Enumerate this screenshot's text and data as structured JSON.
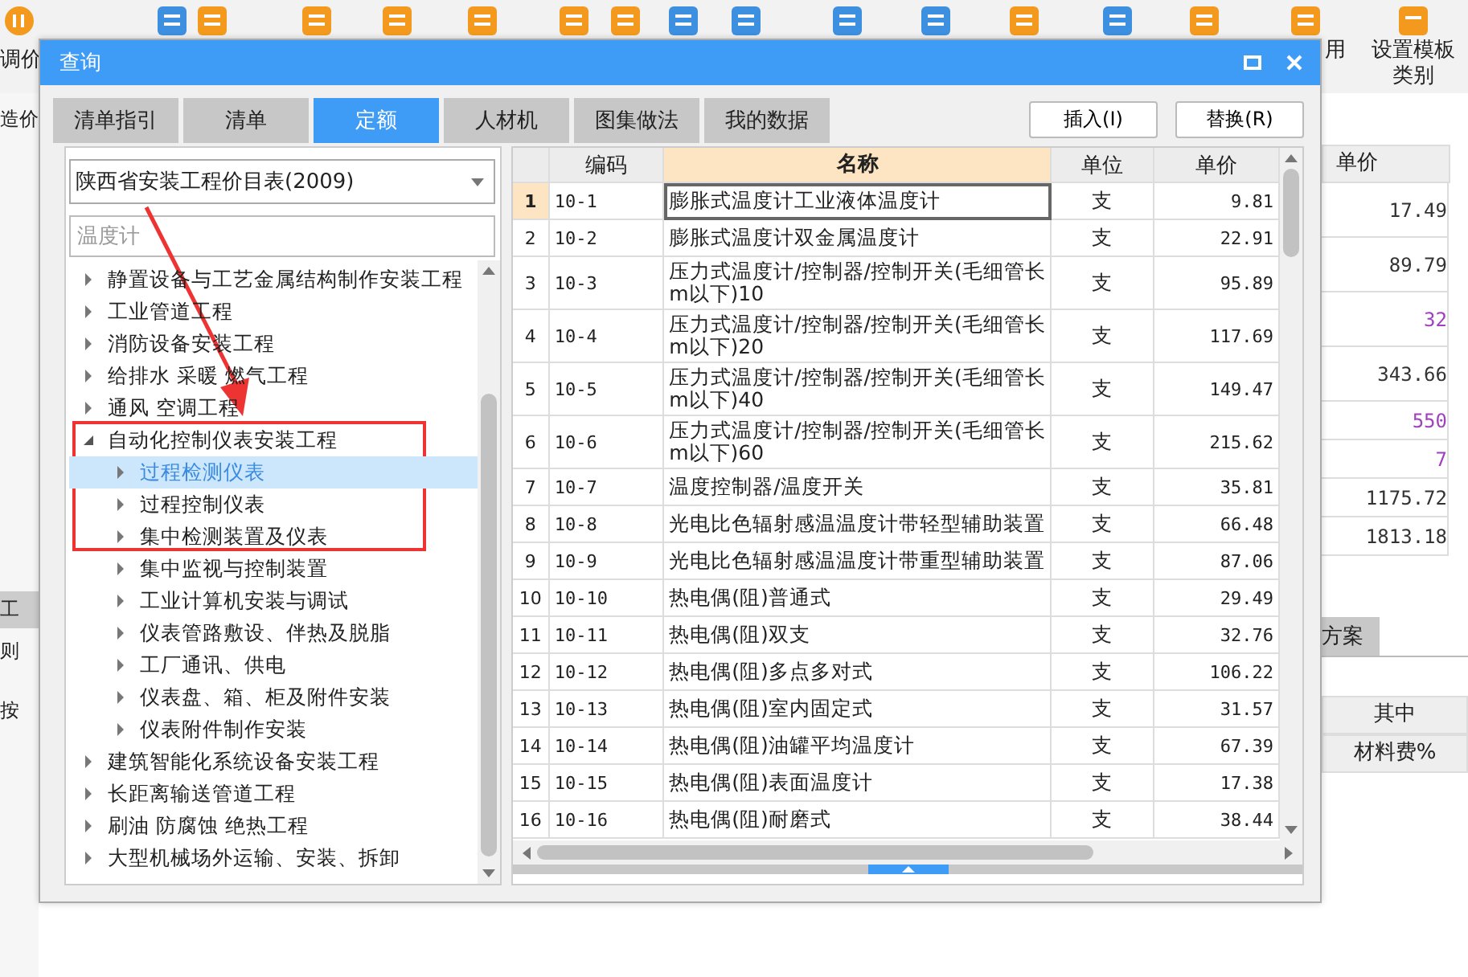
{
  "app": {
    "toolbar_left_label": "调价",
    "toolbar_right_labels": [
      "用",
      "设置模板类别"
    ],
    "side_labels": [
      "造价",
      "工",
      "则",
      "按"
    ],
    "price_column": {
      "header": "单价",
      "values": [
        {
          "text": "17.49",
          "color": "#333333"
        },
        {
          "text": "89.79",
          "color": "#333333"
        },
        {
          "text": "32",
          "color": "#a040c0"
        },
        {
          "text": "343.66",
          "color": "#333333"
        },
        {
          "text": "550",
          "color": "#a040c0"
        },
        {
          "text": "7",
          "color": "#a040c0"
        },
        {
          "text": "1175.72",
          "color": "#333333"
        },
        {
          "text": "1813.18",
          "color": "#333333"
        }
      ]
    },
    "lower_tab": "方案",
    "lower_headers": [
      "其中",
      "材料费%"
    ]
  },
  "window": {
    "title": "查询"
  },
  "tabs": [
    {
      "label": "清单指引",
      "selected": false
    },
    {
      "label": "清单",
      "selected": false
    },
    {
      "label": "定额",
      "selected": true
    },
    {
      "label": "人材机",
      "selected": false
    },
    {
      "label": "图集做法",
      "selected": false
    },
    {
      "label": "我的数据",
      "selected": false
    }
  ],
  "buttons": [
    "插入(I)",
    "替换(R)"
  ],
  "library_select": {
    "value": "陕西省安装工程价目表(2009)"
  },
  "search": {
    "placeholder": "温度计"
  },
  "tree": {
    "items": [
      {
        "label": "静置设备与工艺金属结构制作安装工程",
        "expanded": false,
        "selected": false
      },
      {
        "label": "工业管道工程",
        "expanded": false,
        "selected": false
      },
      {
        "label": "消防设备安装工程",
        "expanded": false,
        "selected": false
      },
      {
        "label": "给排水 采暖 燃气工程",
        "expanded": false,
        "selected": false
      },
      {
        "label": "通风 空调工程",
        "expanded": false,
        "selected": false
      },
      {
        "label": "自动化控制仪表安装工程",
        "expanded": true,
        "selected": false,
        "children": [
          {
            "label": "过程检测仪表",
            "expanded": false,
            "selected": true
          },
          {
            "label": "过程控制仪表",
            "expanded": false,
            "selected": false
          },
          {
            "label": "集中检测装置及仪表",
            "expanded": false,
            "selected": false
          },
          {
            "label": "集中监视与控制装置",
            "expanded": false,
            "selected": false
          },
          {
            "label": "工业计算机安装与调试",
            "expanded": false,
            "selected": false
          },
          {
            "label": "仪表管路敷设、伴热及脱脂",
            "expanded": false,
            "selected": false
          },
          {
            "label": "工厂通讯、供电",
            "expanded": false,
            "selected": false
          },
          {
            "label": "仪表盘、箱、柜及附件安装",
            "expanded": false,
            "selected": false
          },
          {
            "label": "仪表附件制作安装",
            "expanded": false,
            "selected": false
          }
        ]
      },
      {
        "label": "建筑智能化系统设备安装工程",
        "expanded": false,
        "selected": false
      },
      {
        "label": "长距离输送管道工程",
        "expanded": false,
        "selected": false
      },
      {
        "label": "刷油 防腐蚀 绝热工程",
        "expanded": false,
        "selected": false
      },
      {
        "label": "大型机械场外运输、安装、拆卸",
        "expanded": false,
        "selected": false
      }
    ]
  },
  "table": {
    "columns": [
      {
        "label": "编码",
        "selected": false
      },
      {
        "label": "名称",
        "selected": true
      },
      {
        "label": "单位",
        "selected": false
      },
      {
        "label": "单价",
        "selected": false
      }
    ],
    "rows": [
      {
        "no": "1",
        "code": "10-1",
        "name": "膨胀式温度计工业液体温度计",
        "unit": "支",
        "price": "9.81",
        "selected": true
      },
      {
        "no": "2",
        "code": "10-2",
        "name": "膨胀式温度计双金属温度计",
        "unit": "支",
        "price": "22.91",
        "selected": false
      },
      {
        "no": "3",
        "code": "10-3",
        "name": "压力式温度计/控制器/控制开关(毛细管长m以下)10",
        "unit": "支",
        "price": "95.89",
        "selected": false
      },
      {
        "no": "4",
        "code": "10-4",
        "name": "压力式温度计/控制器/控制开关(毛细管长m以下)20",
        "unit": "支",
        "price": "117.69",
        "selected": false
      },
      {
        "no": "5",
        "code": "10-5",
        "name": "压力式温度计/控制器/控制开关(毛细管长m以下)40",
        "unit": "支",
        "price": "149.47",
        "selected": false
      },
      {
        "no": "6",
        "code": "10-6",
        "name": "压力式温度计/控制器/控制开关(毛细管长m以下)60",
        "unit": "支",
        "price": "215.62",
        "selected": false
      },
      {
        "no": "7",
        "code": "10-7",
        "name": "温度控制器/温度开关",
        "unit": "支",
        "price": "35.81",
        "selected": false
      },
      {
        "no": "8",
        "code": "10-8",
        "name": "光电比色辐射感温温度计带轻型辅助装置",
        "unit": "支",
        "price": "66.48",
        "selected": false
      },
      {
        "no": "9",
        "code": "10-9",
        "name": "光电比色辐射感温温度计带重型辅助装置",
        "unit": "支",
        "price": "87.06",
        "selected": false
      },
      {
        "no": "10",
        "code": "10-10",
        "name": "热电偶(阻)普通式",
        "unit": "支",
        "price": "29.49",
        "selected": false
      },
      {
        "no": "11",
        "code": "10-11",
        "name": "热电偶(阻)双支",
        "unit": "支",
        "price": "32.76",
        "selected": false
      },
      {
        "no": "12",
        "code": "10-12",
        "name": "热电偶(阻)多点多对式",
        "unit": "支",
        "price": "106.22",
        "selected": false
      },
      {
        "no": "13",
        "code": "10-13",
        "name": "热电偶(阻)室内固定式",
        "unit": "支",
        "price": "31.57",
        "selected": false
      },
      {
        "no": "14",
        "code": "10-14",
        "name": "热电偶(阻)油罐平均温度计",
        "unit": "支",
        "price": "67.39",
        "selected": false
      },
      {
        "no": "15",
        "code": "10-15",
        "name": "热电偶(阻)表面温度计",
        "unit": "支",
        "price": "17.38",
        "selected": false
      },
      {
        "no": "16",
        "code": "10-16",
        "name": "热电偶(阻)耐磨式",
        "unit": "支",
        "price": "38.44",
        "selected": false
      }
    ]
  }
}
